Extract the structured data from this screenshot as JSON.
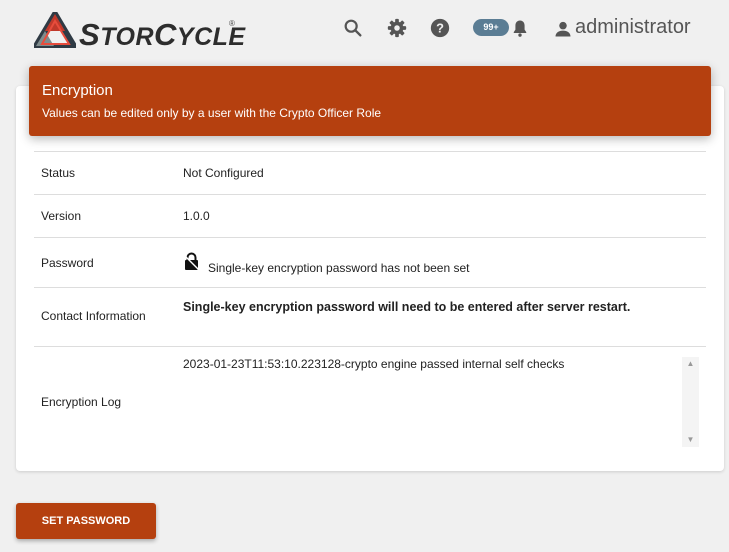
{
  "header": {
    "brand_prefix": "S",
    "brand_mid": "TOR",
    "brand_c": "C",
    "brand_suffix": "YCLE",
    "brand_registered": "®",
    "notifications_badge": "99+",
    "username": "administrator"
  },
  "encryption": {
    "title": "Encryption",
    "subtitle": "Values can be edited only by a user with the Crypto Officer Role",
    "rows": {
      "status": {
        "label": "Status",
        "value": "Not Configured"
      },
      "version": {
        "label": "Version",
        "value": "1.0.0"
      },
      "password": {
        "label": "Password",
        "value": "Single-key encryption password has not been set"
      },
      "contact": {
        "label": "Contact Information",
        "value": "Single-key encryption password will need to be entered after server restart."
      },
      "log": {
        "label": "Encryption Log",
        "value": "2023-01-23T11:53:10.223128-crypto engine passed internal self checks"
      }
    }
  },
  "actions": {
    "set_password_label": "SET PASSWORD"
  },
  "colors": {
    "accent": "#b5400f",
    "badge": "#5b7d94",
    "background": "#f0f0f0"
  },
  "icons": [
    "logo-triangle-icon",
    "search-icon",
    "gear-icon",
    "help-icon",
    "bell-icon",
    "user-icon",
    "lock-icon",
    "scroll-up-icon",
    "scroll-down-icon"
  ]
}
